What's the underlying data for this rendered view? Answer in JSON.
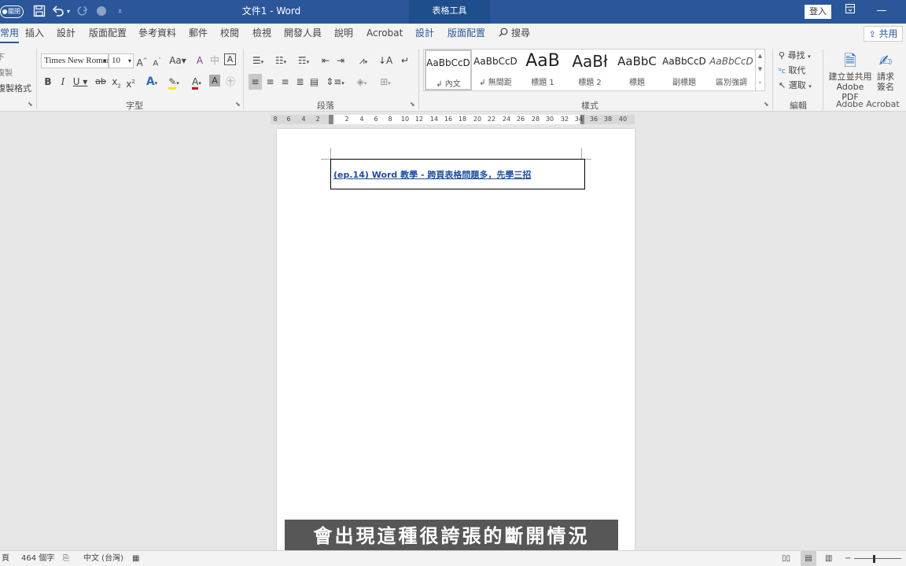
{
  "titlebar": {
    "autosave_label": "關閉",
    "save_icon": "save-icon",
    "undo_icon": "undo-icon",
    "redo_icon": "redo-icon",
    "title": "文件1  -  Word",
    "context_tab": "表格工具",
    "signin_label": "登入",
    "ribbon_display_icon": "ribbon-display-icon",
    "minimize_icon": "minimize-icon"
  },
  "tabs": {
    "home": "常用",
    "insert": "插入",
    "design": "設計",
    "layout": "版面配置",
    "references": "參考資料",
    "mailings": "郵件",
    "review": "校閱",
    "view": "檢視",
    "developer": "開發人員",
    "help": "說明",
    "acrobat": "Acrobat",
    "table_design": "設計",
    "table_layout": "版面配置",
    "search": "搜尋",
    "share": "共用"
  },
  "ribbon": {
    "clipboard": {
      "paste_below": "下",
      "copy": "複製",
      "format_painter": "複製格式"
    },
    "font": {
      "font_name": "Times New Roman",
      "font_size": "10",
      "label": "字型"
    },
    "paragraph": {
      "label": "段落"
    },
    "styles": {
      "label": "樣式",
      "items": [
        {
          "sample": "AaBbCcD",
          "name": "↲ 內文"
        },
        {
          "sample": "AaBbCcD",
          "name": "↲ 無間距"
        },
        {
          "sample": "AaB",
          "name": "標題 1"
        },
        {
          "sample": "AaBł",
          "name": "標題 2"
        },
        {
          "sample": "AaBbC",
          "name": "標題"
        },
        {
          "sample": "AaBbCcD",
          "name": "副標題"
        },
        {
          "sample": "AaBbCcD",
          "name": "區別強調"
        }
      ]
    },
    "editing": {
      "label": "編輯",
      "find": "尋找",
      "replace": "取代",
      "select": "選取"
    },
    "acrobat": {
      "label": "Adobe Acrobat",
      "create_line1": "建立並共用",
      "create_line2": "Adobe PDF",
      "request_line1": "請求",
      "request_line2": "簽名"
    }
  },
  "ruler": {
    "left_ticks": [
      "8",
      "6",
      "4",
      "2"
    ],
    "right_ticks": [
      "2",
      "4",
      "6",
      "8",
      "10",
      "12",
      "14",
      "16",
      "18",
      "20",
      "22",
      "24",
      "26",
      "28",
      "30",
      "32",
      "34",
      "36",
      "38",
      "40"
    ]
  },
  "document": {
    "cell_text": "(ep.14) Word 教學 - 跨頁表格問題多，先學三招"
  },
  "subtitle": "會出現這種很誇張的斷開情況",
  "status": {
    "page": "頁",
    "word_count": "464 個字",
    "language": "中文 (台灣)"
  }
}
